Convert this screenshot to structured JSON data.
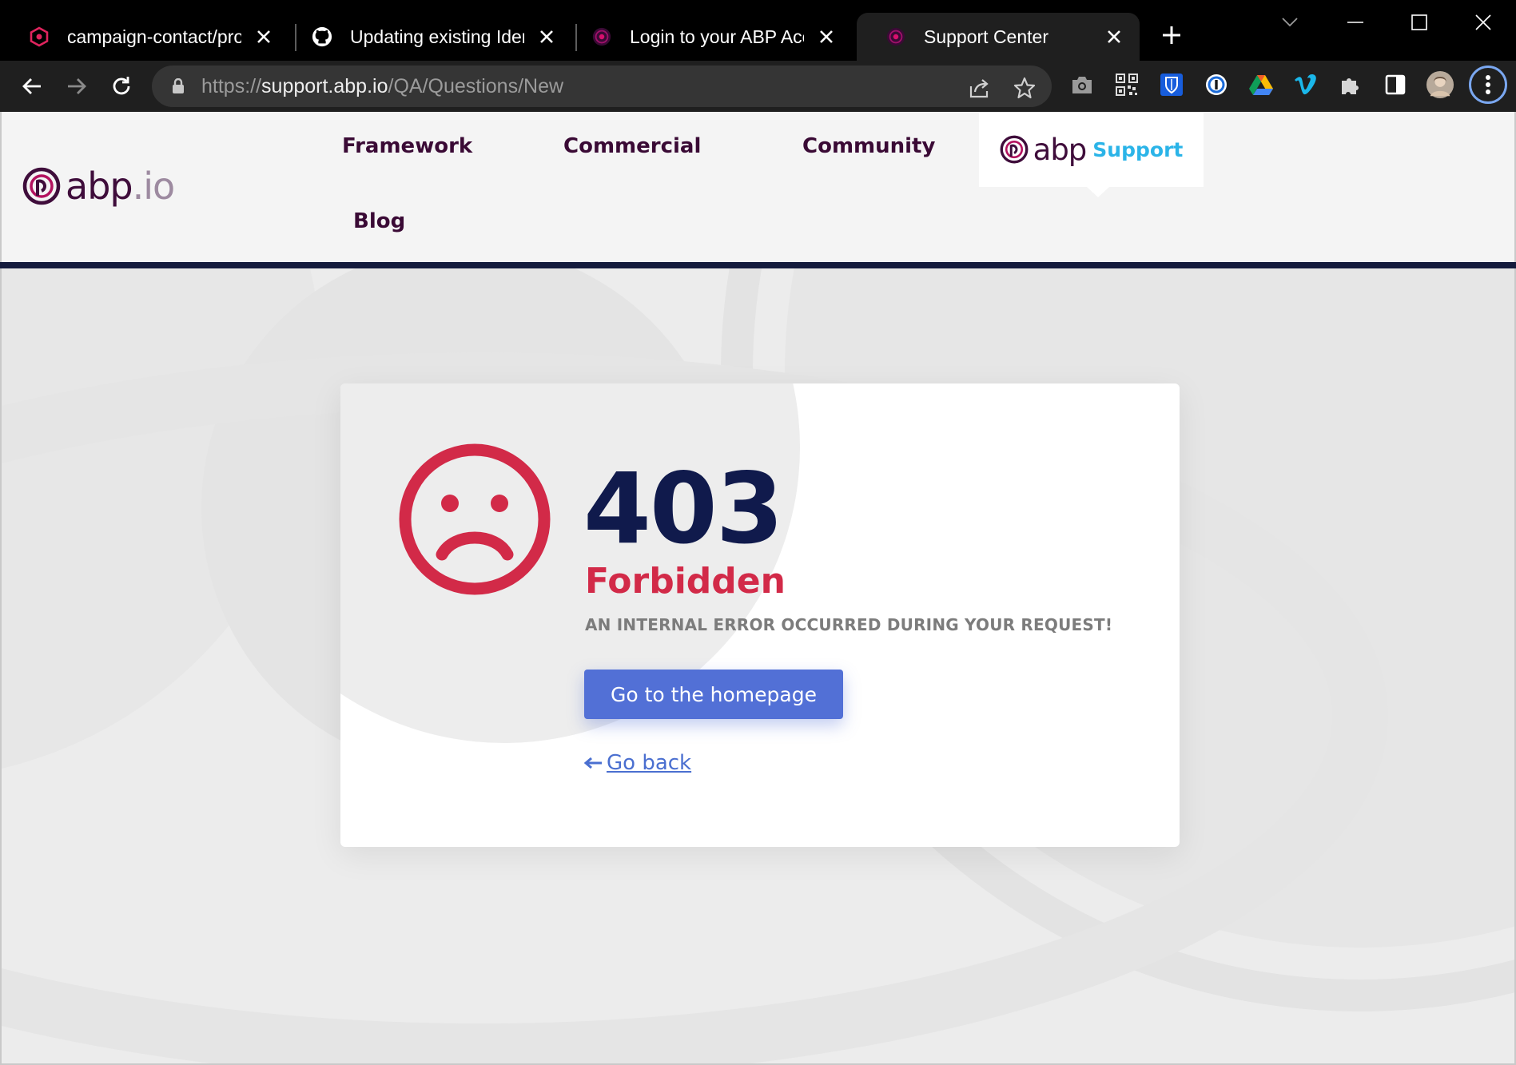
{
  "browser": {
    "tabs": [
      {
        "title": "campaign-contact/process",
        "favicon": "hexagon-logo-icon"
      },
      {
        "title": "Updating existing Identity",
        "favicon": "github-icon"
      },
      {
        "title": "Login to your ABP Account",
        "favicon": "abp-logo-icon"
      },
      {
        "title": "Support Center",
        "favicon": "abp-logo-icon"
      }
    ],
    "url": {
      "scheme": "https://",
      "host": "support.abp.io",
      "path": "/QA/Questions/New"
    }
  },
  "site": {
    "logo": {
      "main": "abp",
      "suffix": ".io"
    },
    "nav": [
      {
        "label": "Framework"
      },
      {
        "label": "Commercial"
      },
      {
        "label": "Community"
      },
      {
        "label": "Blog"
      }
    ],
    "support": {
      "brand": "abp",
      "label": "Support"
    }
  },
  "error": {
    "code": "403",
    "status": "Forbidden",
    "message": "AN INTERNAL ERROR OCCURRED DURING YOUR REQUEST!",
    "home_button": "Go to the homepage",
    "back_link": "Go back"
  },
  "colors": {
    "error_red": "#d22a48",
    "code_navy": "#101a4c",
    "button_blue": "#5270d6",
    "brand_purple": "#3f0d3b",
    "support_cyan": "#2bb4e8"
  }
}
